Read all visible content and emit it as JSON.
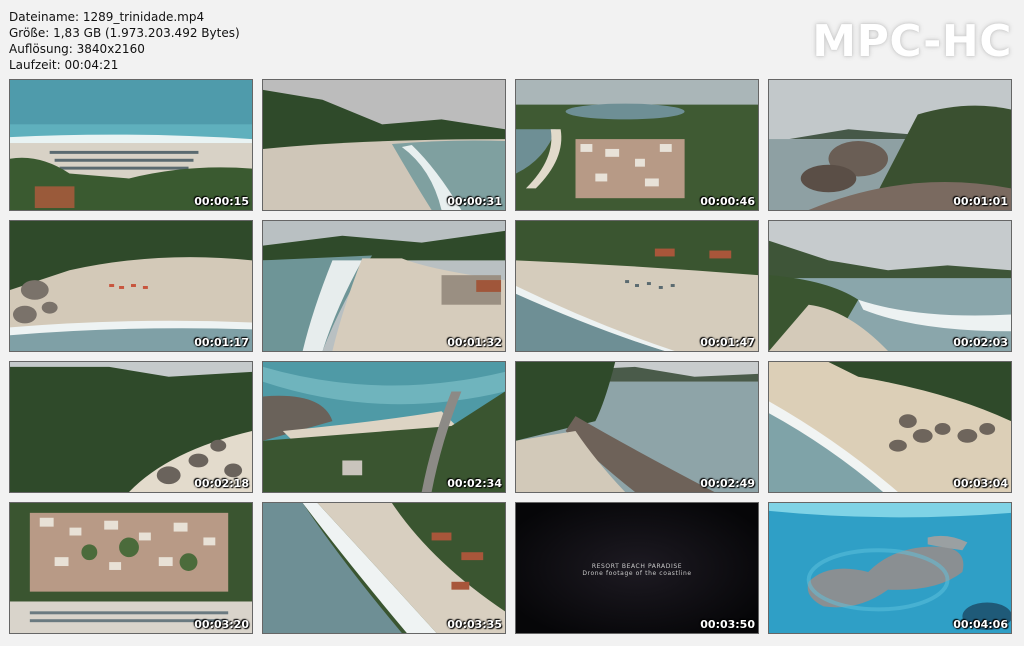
{
  "file_info": {
    "name": "Dateiname: 1289_trinidade.mp4",
    "size": "Größe: 1,83 GB (1.973.203.492 Bytes)",
    "resolution": "Auflösung: 3840x2160",
    "duration": "Laufzeit: 00:04:21"
  },
  "logo": "MPC-HC",
  "thumbnails": [
    {
      "time": "00:00:15",
      "scene": "beach-umbrellas"
    },
    {
      "time": "00:00:31",
      "scene": "beach-waves"
    },
    {
      "time": "00:00:46",
      "scene": "village-bay"
    },
    {
      "time": "00:01:01",
      "scene": "rocky-coast"
    },
    {
      "time": "00:01:17",
      "scene": "beach-rocks-aerial"
    },
    {
      "time": "00:01:32",
      "scene": "beach-shore-curve"
    },
    {
      "time": "00:01:47",
      "scene": "beach-cars"
    },
    {
      "time": "00:02:03",
      "scene": "beach-cove"
    },
    {
      "time": "00:02:18",
      "scene": "forest-coast"
    },
    {
      "time": "00:02:34",
      "scene": "rocky-road"
    },
    {
      "time": "00:02:49",
      "scene": "rocky-point"
    },
    {
      "time": "00:03:04",
      "scene": "boulders-beach"
    },
    {
      "time": "00:03:20",
      "scene": "village-aerial"
    },
    {
      "time": "00:03:35",
      "scene": "long-beach"
    },
    {
      "time": "00:03:50",
      "scene": "title-card"
    },
    {
      "time": "00:04:06",
      "scene": "island-turquoise"
    }
  ],
  "title_card": {
    "line1": "RESORT BEACH PARADISE",
    "line2": "Drone footage of the coastline"
  },
  "colors": {
    "background": "#f2f2f2",
    "sea_turquoise": "#3aa9c9",
    "sea_grey": "#6e8f95",
    "sand": "#d9cfc0",
    "forest": "#2f4a2a"
  }
}
